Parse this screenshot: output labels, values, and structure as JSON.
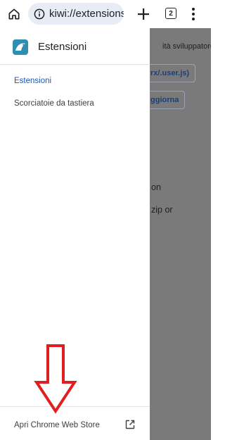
{
  "toolbar": {
    "url": "kiwi://extensions",
    "tab_count": "2"
  },
  "drawer": {
    "title": "Estensioni",
    "items": [
      {
        "label": "Estensioni",
        "active": true
      },
      {
        "label": "Scorciatoie da tastiera",
        "active": false
      }
    ],
    "footer_label": "Apri Chrome Web Store"
  },
  "background_page": {
    "dev_mode_label": "ità sviluppatore",
    "load_button": "rx/.user.js)",
    "update_button": "ggiorna",
    "line1": "on",
    "line2": "zip or"
  },
  "colors": {
    "accent": "#1a57b0",
    "urlbar_bg": "#e8edf5",
    "overlay": "#7a7a7a",
    "annotation_arrow": "#e02020"
  },
  "icons": {
    "home": "home-icon",
    "info": "info-icon",
    "new_tab": "plus-icon",
    "tabs": "tab-switcher-icon",
    "menu": "more-vert-icon",
    "logo": "kiwi-logo-icon",
    "open_external": "open-in-new-icon",
    "annotation": "red-down-arrow-icon"
  }
}
